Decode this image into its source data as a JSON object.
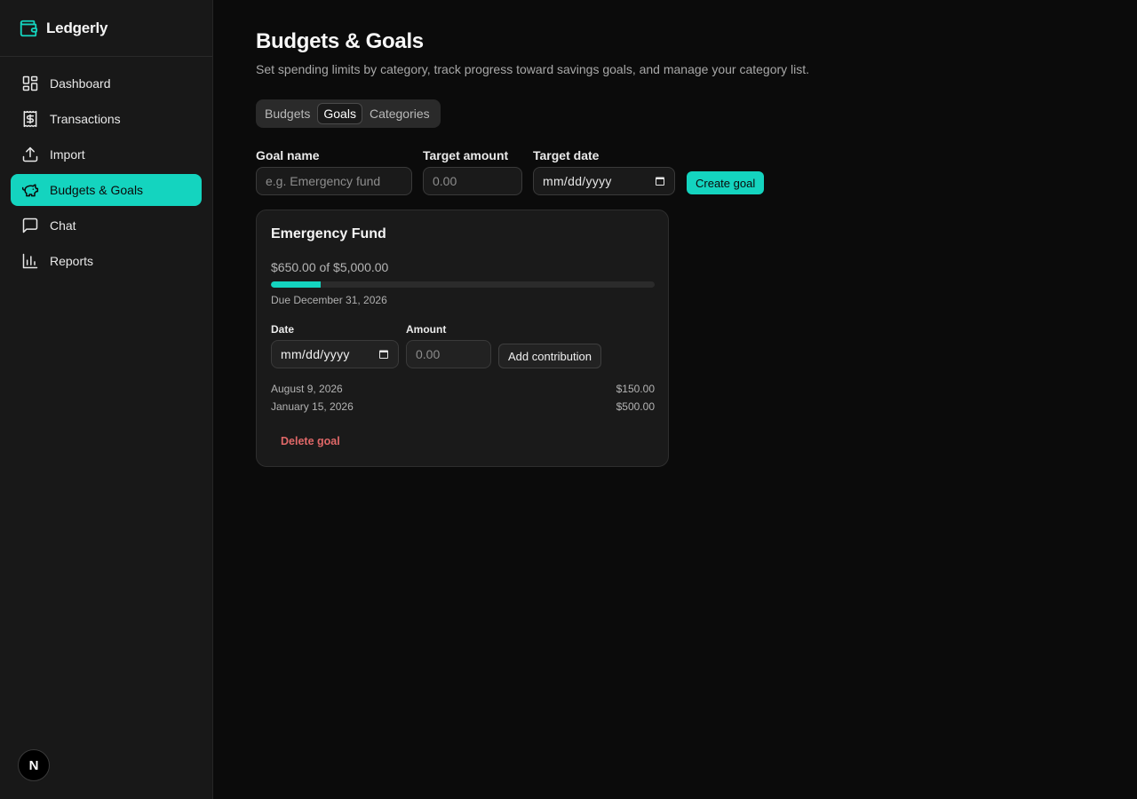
{
  "app": {
    "name": "Ledgerly",
    "accent": "#14d4bf",
    "danger": "#e06868"
  },
  "sidebar": {
    "items": [
      {
        "label": "Dashboard",
        "icon": "dashboard-icon",
        "active": false
      },
      {
        "label": "Transactions",
        "icon": "receipt-dollar-icon",
        "active": false
      },
      {
        "label": "Import",
        "icon": "upload-icon",
        "active": false
      },
      {
        "label": "Budgets & Goals",
        "icon": "piggy-bank-icon",
        "active": true
      },
      {
        "label": "Chat",
        "icon": "chat-bubble-icon",
        "active": false
      },
      {
        "label": "Reports",
        "icon": "bar-chart-icon",
        "active": false
      }
    ],
    "footer_badge": "N"
  },
  "header": {
    "title": "Budgets & Goals",
    "subtitle": "Set spending limits by category, track progress toward savings goals, and manage your category list."
  },
  "tabs": [
    {
      "label": "Budgets",
      "active": false
    },
    {
      "label": "Goals",
      "active": true
    },
    {
      "label": "Categories",
      "active": false
    }
  ],
  "create_form": {
    "goal_name_label": "Goal name",
    "goal_name_placeholder": "e.g. Emergency fund",
    "target_amount_label": "Target amount",
    "target_amount_placeholder": "0.00",
    "target_date_label": "Target date",
    "target_date_placeholder": "mm/dd/yyyy",
    "submit_label": "Create goal"
  },
  "goal": {
    "name": "Emergency Fund",
    "progress_text": "$650.00 of $5,000.00",
    "progress_fraction": 0.13,
    "due_text": "Due December 31, 2026",
    "contribution_form": {
      "date_label": "Date",
      "date_placeholder": "mm/dd/yyyy",
      "amount_label": "Amount",
      "amount_placeholder": "0.00",
      "submit_label": "Add contribution"
    },
    "contributions": [
      {
        "date": "August 9, 2026",
        "amount": "$150.00"
      },
      {
        "date": "January 15, 2026",
        "amount": "$500.00"
      }
    ],
    "delete_label": "Delete goal"
  }
}
